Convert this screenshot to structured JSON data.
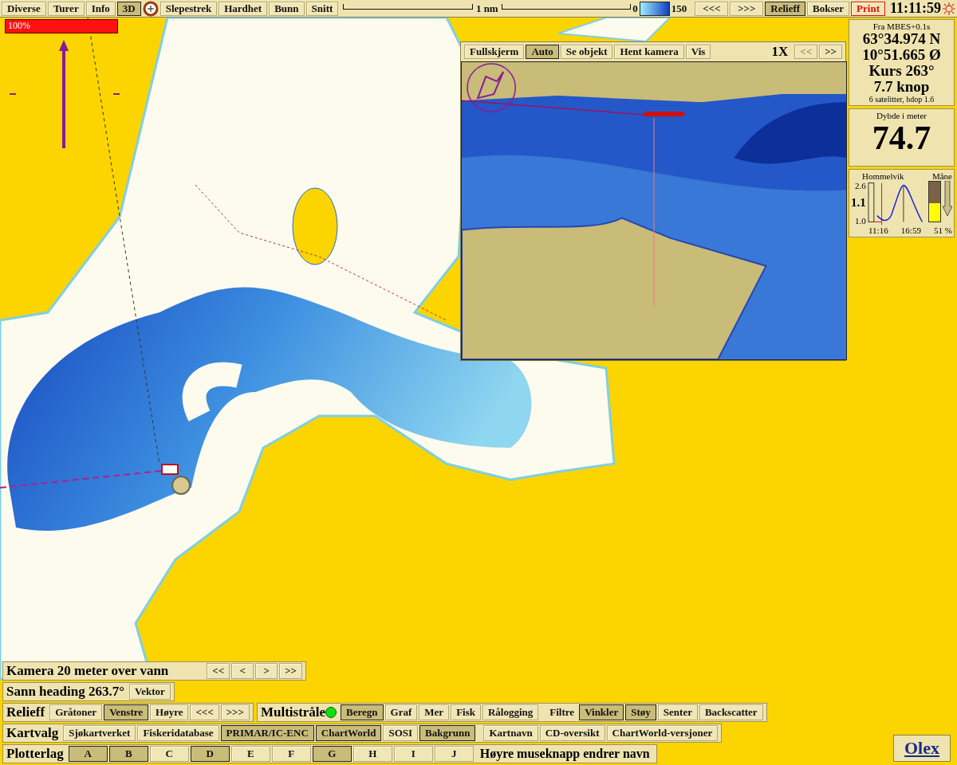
{
  "toolbar": {
    "left_buttons": [
      {
        "label": "Diverse",
        "selected": false
      },
      {
        "label": "Turer",
        "selected": false
      },
      {
        "label": "Info",
        "selected": false
      },
      {
        "label": "3D",
        "selected": true
      }
    ],
    "mid_buttons": [
      {
        "label": "Slepestrek",
        "selected": false
      },
      {
        "label": "Hardhet",
        "selected": false
      },
      {
        "label": "Bunn",
        "selected": false
      },
      {
        "label": "Snitt",
        "selected": false
      }
    ],
    "scale": {
      "label": "1 nm"
    },
    "depth_legend": {
      "min": "0",
      "max": "150"
    },
    "right_buttons": [
      {
        "label": "<<<",
        "selected": false,
        "kind": "normal"
      },
      {
        "label": ">>>",
        "selected": false,
        "kind": "normal"
      },
      {
        "label": "Relieff",
        "selected": true,
        "kind": "normal"
      },
      {
        "label": "Bokser",
        "selected": false,
        "kind": "normal"
      },
      {
        "label": "Print",
        "selected": false,
        "kind": "alert"
      }
    ],
    "clock": "11:11:59"
  },
  "zoom_bar": {
    "label": "100%",
    "level": 1
  },
  "view_3d": {
    "buttons": [
      {
        "label": "Fullskjerm",
        "selected": false
      },
      {
        "label": "Auto",
        "selected": true
      },
      {
        "label": "Se objekt",
        "selected": false
      },
      {
        "label": "Hent kamera",
        "selected": false
      },
      {
        "label": "Vis",
        "selected": false
      }
    ],
    "zoom": "1X",
    "nav": [
      {
        "label": "<<",
        "disabled": true
      },
      {
        "label": ">>",
        "disabled": false
      }
    ]
  },
  "position_panel": {
    "source": "Fra MBES+0.1s",
    "latitude": "63°34.974 N",
    "longitude": "10°51.665 Ø",
    "course": "Kurs 263°",
    "speed": "7.7 knop",
    "gps": "6 satelitter, hdop 1.6"
  },
  "depth_panel": {
    "title": "Dybde i meter",
    "value": "74.7"
  },
  "tide_panel": {
    "place": "Hommelvik",
    "moon_label": "Måne",
    "high": "2.6",
    "current": "1.1",
    "low": "1.0",
    "times": [
      "11:16",
      "16:59"
    ],
    "moon": {
      "level": 0.45,
      "reading": "51 %"
    }
  },
  "camera_bar": {
    "label": "Kamera 20 meter over vann",
    "buttons": [
      "<<",
      "<",
      ">",
      ">>"
    ]
  },
  "heading_bar": {
    "label": "Sann heading 263.7°",
    "buttons": [
      {
        "label": "Vektor",
        "selected": false
      }
    ]
  },
  "relief_bar": {
    "label": "Relieff",
    "buttons": [
      {
        "label": "Gråtoner",
        "selected": false
      },
      {
        "label": "Venstre",
        "selected": true
      },
      {
        "label": "Høyre",
        "selected": false
      },
      {
        "label": "<<<",
        "selected": false
      },
      {
        "label": ">>>",
        "selected": false
      }
    ]
  },
  "multibeam_bar": {
    "label": "Multistråle",
    "active": true,
    "buttons": [
      {
        "label": "Beregn",
        "selected": true
      },
      {
        "label": "Graf",
        "selected": false
      },
      {
        "label": "Mer",
        "selected": false
      },
      {
        "label": "Fisk",
        "selected": false
      },
      {
        "label": "Rålogging",
        "selected": false
      }
    ],
    "filter_label": "Filtre",
    "filters": [
      {
        "label": "Vinkler",
        "selected": true
      },
      {
        "label": "Støy",
        "selected": true
      },
      {
        "label": "Senter",
        "selected": false
      },
      {
        "label": "Backscatter",
        "selected": false
      }
    ]
  },
  "chart_bar": {
    "label": "Kartvalg",
    "buttons": [
      {
        "label": "Sjøkartverket",
        "selected": false
      },
      {
        "label": "Fiskeridatabase",
        "selected": false
      },
      {
        "label": "PRIMAR/IC-ENC",
        "selected": true
      },
      {
        "label": "ChartWorld",
        "selected": true
      },
      {
        "label": "SOSI",
        "selected": false
      },
      {
        "label": "Bakgrunn",
        "selected": true
      }
    ],
    "extra_buttons": [
      {
        "label": "Kartnavn",
        "selected": false
      },
      {
        "label": "CD-oversikt",
        "selected": false
      },
      {
        "label": "ChartWorld-versjoner",
        "selected": false
      }
    ]
  },
  "plotter_bar": {
    "label": "Plotterlag",
    "buttons": [
      {
        "label": "A",
        "selected": true
      },
      {
        "label": "B",
        "selected": true
      },
      {
        "label": "C",
        "selected": false
      },
      {
        "label": "D",
        "selected": true
      },
      {
        "label": "E",
        "selected": false
      },
      {
        "label": "F",
        "selected": false
      },
      {
        "label": "G",
        "selected": true
      },
      {
        "label": "H",
        "selected": false
      },
      {
        "label": "I",
        "selected": false
      },
      {
        "label": "J",
        "selected": false
      }
    ],
    "hint": "Høyre museknapp endrer navn"
  },
  "logo": "Olex"
}
